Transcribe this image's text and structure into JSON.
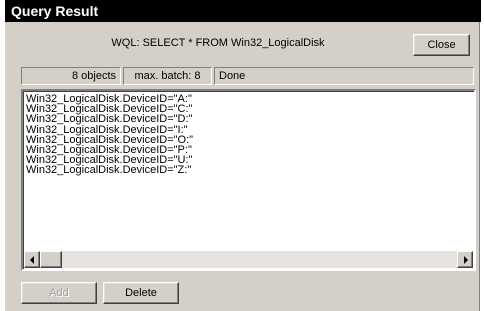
{
  "window": {
    "title": "Query Result"
  },
  "query": {
    "text": "WQL: SELECT * FROM Win32_LogicalDisk"
  },
  "buttons": {
    "close": "Close",
    "add": "Add",
    "delete": "Delete"
  },
  "status": {
    "objects": "8 objects",
    "batch": "max. batch: 8",
    "state": "Done"
  },
  "results": [
    "Win32_LogicalDisk.DeviceID=\"A:\"",
    "Win32_LogicalDisk.DeviceID=\"C:\"",
    "Win32_LogicalDisk.DeviceID=\"D:\"",
    "Win32_LogicalDisk.DeviceID=\"I:\"",
    "Win32_LogicalDisk.DeviceID=\"O:\"",
    "Win32_LogicalDisk.DeviceID=\"P:\"",
    "Win32_LogicalDisk.DeviceID=\"U:\"",
    "Win32_LogicalDisk.DeviceID=\"Z:\""
  ]
}
